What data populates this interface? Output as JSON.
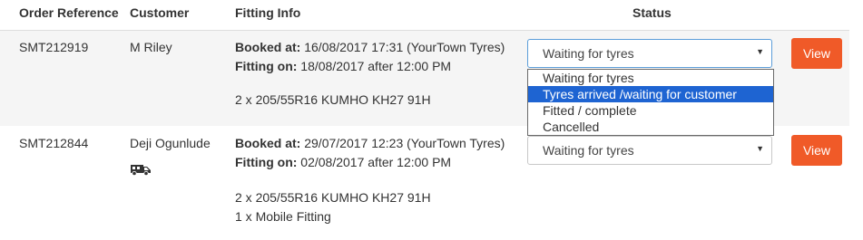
{
  "headers": {
    "order_reference": "Order Reference",
    "customer": "Customer",
    "fitting_info": "Fitting Info",
    "status": "Status"
  },
  "rows": [
    {
      "order_ref": "SMT212919",
      "customer": "M Riley",
      "booked_label": "Booked at:",
      "booked_value": " 16/08/2017 17:31 (YourTown Tyres)",
      "fitting_label": "Fitting on:",
      "fitting_value": " 18/08/2017 after 12:00 PM",
      "items": [
        "2 x 205/55R16 KUMHO KH27 91H"
      ],
      "status_value": "Waiting for tyres",
      "view_label": "View"
    },
    {
      "order_ref": "SMT212844",
      "customer": "Deji Ogunlude",
      "customer_icon": "mobile-fitting-van-icon",
      "booked_label": "Booked at:",
      "booked_value": " 29/07/2017 12:23 (YourTown Tyres)",
      "fitting_label": "Fitting on:",
      "fitting_value": " 02/08/2017 after 12:00 PM",
      "items": [
        "2 x 205/55R16 KUMHO KH27 91H",
        "1 x Mobile Fitting"
      ],
      "status_value": "Waiting for tyres",
      "view_label": "View"
    }
  ],
  "status_dropdown": {
    "options": [
      "Waiting for tyres",
      "Tyres arrived /waiting for customer",
      "Fitted / complete",
      "Cancelled"
    ],
    "highlighted_index": 1
  },
  "colors": {
    "accent": "#f05a28",
    "highlight": "#1e64d2",
    "row_alt": "#f5f5f5"
  }
}
